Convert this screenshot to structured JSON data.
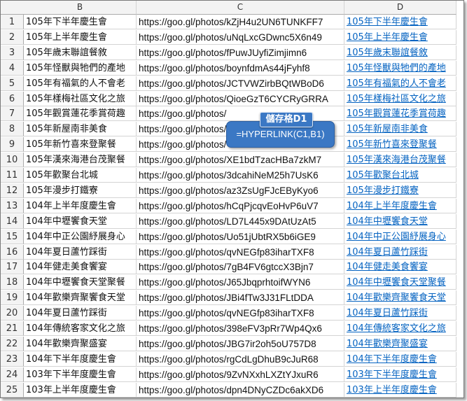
{
  "columns": [
    "B",
    "C",
    "D"
  ],
  "rows": [
    {
      "n": "1",
      "b": "105年下半年慶生會",
      "c": "https://goo.gl/photos/kZjH4u2UN6TUNKFF7",
      "d": "105年下半年慶生會"
    },
    {
      "n": "2",
      "b": "105年上半年慶生會",
      "c": "https://goo.gl/photos/uNqLxcGDwnc5X6n49",
      "d": "105年上半年慶生會"
    },
    {
      "n": "3",
      "b": "105年歲末聯誼餐敘",
      "c": "https://goo.gl/photos/fPuwJUyfiZimjimn6",
      "d": "105年歲末聯誼餐敘"
    },
    {
      "n": "4",
      "b": "105年怪獸與牠們的產地",
      "c": "https://goo.gl/photos/boynfdmAs44jFyhf8",
      "d": "105年怪獸與牠們的產地"
    },
    {
      "n": "5",
      "b": "105年有福氣的人不會老",
      "c": "https://goo.gl/photos/JCTVWZirbBQtWBoD6",
      "d": "105年有福氣的人不會老"
    },
    {
      "n": "6",
      "b": "105年樣梅社區文化之旅",
      "c": "https://goo.gl/photos/QioeGzT6CYCRyGRRA",
      "d": "105年樣梅社區文化之旅"
    },
    {
      "n": "7",
      "b": "105年觀賞蓮花季賞荷趣",
      "c": "https://goo.gl/photos/",
      "d": "105年觀賞蓮花季賞荷趣"
    },
    {
      "n": "8",
      "b": "105年新屋南非美食",
      "c": "https://goo.gl/photos/",
      "d": "105年新屋南非美食"
    },
    {
      "n": "9",
      "b": "105年新竹喜來登聚餐",
      "c": "https://goo.gl/photos/",
      "d": "105年新竹喜來登聚餐"
    },
    {
      "n": "10",
      "b": "105年漢來海港台茂聚餐",
      "c": "https://goo.gl/photos/XE1bdTzacHBa7zkM7",
      "d": "105年漢來海港台茂聚餐"
    },
    {
      "n": "11",
      "b": "105年歡聚台北城",
      "c": "https://goo.gl/photos/3dcahiNeM25h7UsK6",
      "d": "105年歡聚台北城"
    },
    {
      "n": "12",
      "b": "105年漫步打鐵寮",
      "c": "https://goo.gl/photos/az3ZsUgFJcEByKyo6",
      "d": "105年漫步打鐵寮"
    },
    {
      "n": "13",
      "b": "104年上半年度慶生會",
      "c": "https://goo.gl/photos/hCqPjcqvEoHvP6uV7",
      "d": "104年上半年度慶生會"
    },
    {
      "n": "14",
      "b": "104年中壢饗食天堂",
      "c": "https://goo.gl/photos/LD7L445x9DAtUzAt5",
      "d": "104年中壢饗食天堂"
    },
    {
      "n": "15",
      "b": "104年中正公園紓展身心",
      "c": "https://goo.gl/photos/Uo51jUbtRX5b6iGE9",
      "d": "104年中正公園紓展身心"
    },
    {
      "n": "16",
      "b": "104年夏日蘆竹踩街",
      "c": "https://goo.gl/photos/qvNEGfp83iharTXF8",
      "d": "104年夏日蘆竹踩街"
    },
    {
      "n": "17",
      "b": "104年健走美食饗宴",
      "c": "https://goo.gl/photos/7gB4FV6gtccX3Bjn7",
      "d": "104年健走美食饗宴"
    },
    {
      "n": "18",
      "b": "104年中壢饗食天堂聚餐",
      "c": "https://goo.gl/photos/J65JbqprhtoifWYN6",
      "d": "104年中壢饗食天堂聚餐"
    },
    {
      "n": "19",
      "b": "104年歡樂齊聚饗食天堂",
      "c": "https://goo.gl/photos/JBi4fTw3J31FLtDDA",
      "d": "104年歡樂齊聚饗食天堂"
    },
    {
      "n": "20",
      "b": "104年夏日蘆竹踩街",
      "c": "https://goo.gl/photos/qvNEGfp83iharTXF8",
      "d": "104年夏日蘆竹踩街"
    },
    {
      "n": "21",
      "b": "104年傳統客家文化之旅",
      "c": "https://goo.gl/photos/398eFV3pRr7Wp4Qx6",
      "d": "104年傳統客家文化之旅"
    },
    {
      "n": "22",
      "b": "104年歡樂齊聚盛宴",
      "c": "https://goo.gl/photos/JBG7ir2oh5oU757D8",
      "d": "104年歡樂齊聚盛宴"
    },
    {
      "n": "23",
      "b": "104年下半年度慶生會",
      "c": "https://goo.gl/photos/rgCdLgDhuB9cJuR68",
      "d": "104年下半年度慶生會"
    },
    {
      "n": "24",
      "b": "103年下半年度慶生會",
      "c": "https://goo.gl/photos/9ZvNXxhLXZtYJxuR6",
      "d": "103年下半年度慶生會"
    },
    {
      "n": "25",
      "b": "103年上半年度慶生會",
      "c": "https://goo.gl/photos/dpn4DNyCZDc6akXD6",
      "d": "103年上半年度慶生會"
    }
  ],
  "callout": {
    "title": "儲存格D1",
    "formula": "=HYPERLINK(C1,B1)"
  },
  "colors": {
    "link": "#0563c1",
    "callout_bg": "#3b78c4",
    "header_bg": "#f3f3f3"
  }
}
